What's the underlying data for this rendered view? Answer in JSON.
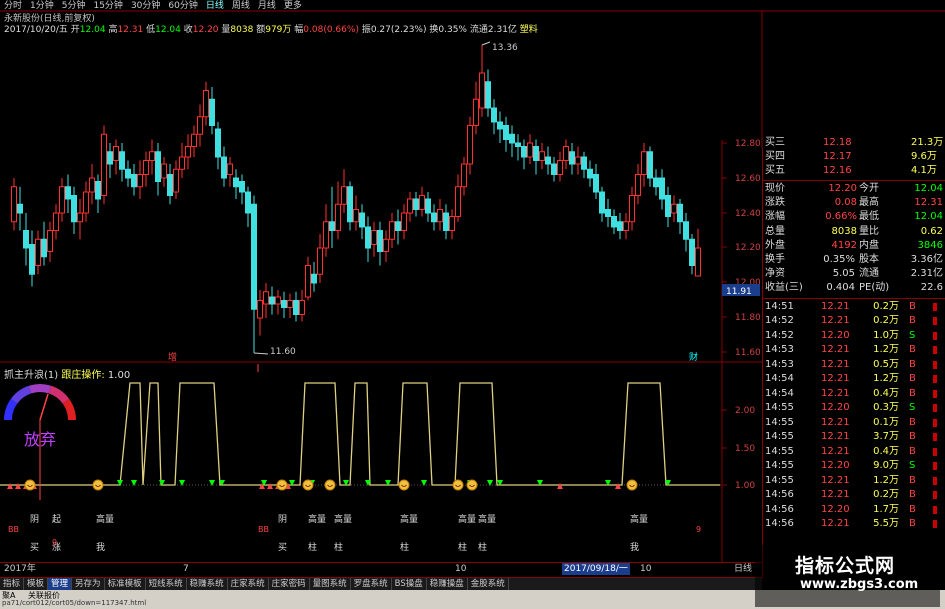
{
  "timeframes": [
    "分时",
    "1分钟",
    "5分钟",
    "15分钟",
    "30分钟",
    "60分钟",
    "日线",
    "周线",
    "月线",
    "更多"
  ],
  "active_timeframe": "日线",
  "stock_title": "永新股份(日线,前复权)",
  "info": {
    "date": "2017/10/20/五",
    "open_label": "开",
    "open": "12.04",
    "high_label": "高",
    "high": "12.31",
    "low_label": "低",
    "low": "12.04",
    "close_label": "收",
    "close": "12.20",
    "vol_label": "量",
    "vol": "8038",
    "amount_label": "额",
    "amount": "979万",
    "change_label": "幅",
    "change": "0.08(0.66%)",
    "amp_label": "振",
    "amp": "0.27(2.23%)",
    "turn_label": "换",
    "turn": "0.35%",
    "float_label": "流通",
    "float": "2.31亿",
    "type": "塑料"
  },
  "price_axis": [
    "12.80",
    "12.60",
    "12.40",
    "12.20",
    "12.00",
    "11.80",
    "11.60"
  ],
  "current_price_tag": "11.91",
  "max_label": "13.36",
  "min_label": "11.60",
  "markers": {
    "zeng": "增",
    "cai": "财"
  },
  "indicator_title": "抓主升浪(1)",
  "indicator_sub": "跟庄操作:",
  "indicator_val": "1.00",
  "gauge_text": "放弃",
  "ind_axis": [
    "2.00",
    "1.50",
    "1.00"
  ],
  "bottom_labels": [
    {
      "t": "阴",
      "sub": "买"
    },
    {
      "t": "起",
      "sub": "涨"
    },
    {
      "t": "高量",
      "sub": "我"
    },
    {
      "t": "阴",
      "sub": "买"
    },
    {
      "t": "高量",
      "sub": "柱"
    },
    {
      "t": "高量",
      "sub": "柱"
    },
    {
      "t": "高量",
      "sub": "柱"
    },
    {
      "t": "高量",
      "sub": "柱"
    },
    {
      "t": "高量",
      "sub": "柱"
    },
    {
      "t": "高量",
      "sub": "我"
    }
  ],
  "date_axis": {
    "left": "2017年",
    "m7": "7",
    "m10": "10",
    "cursor_date": "2017/09/18/一",
    "tag": "日线"
  },
  "quote": [
    {
      "label": "买三",
      "value": "12.18",
      "extra": "21.3万"
    },
    {
      "label": "买四",
      "value": "12.17",
      "extra": "9.6万"
    },
    {
      "label": "买五",
      "value": "12.16",
      "extra": "4.1万"
    }
  ],
  "stats": [
    {
      "l1": "现价",
      "v1": "12.20",
      "l2": "今开",
      "v2": "12.04"
    },
    {
      "l1": "涨跌",
      "v1": "0.08",
      "l2": "最高",
      "v2": "12.31"
    },
    {
      "l1": "涨幅",
      "v1": "0.66%",
      "l2": "最低",
      "v2": "12.04"
    },
    {
      "l1": "总量",
      "v1": "8038",
      "l2": "量比",
      "v2": "0.62"
    },
    {
      "l1": "外盘",
      "v1": "4192",
      "l2": "内盘",
      "v2": "3846"
    },
    {
      "l1": "换手",
      "v1": "0.35%",
      "l2": "股本",
      "v2": "3.36亿"
    },
    {
      "l1": "净资",
      "v1": "5.05",
      "l2": "流通",
      "v2": "2.31亿"
    },
    {
      "l1": "收益(三)",
      "v1": "0.404",
      "l2": "PE(动)",
      "v2": "22.6"
    }
  ],
  "ticks": [
    {
      "t": "14:51",
      "p": "12.21",
      "v": "0.2万",
      "s": "B"
    },
    {
      "t": "14:52",
      "p": "12.21",
      "v": "0.2万",
      "s": "B"
    },
    {
      "t": "14:52",
      "p": "12.20",
      "v": "1.0万",
      "s": "S"
    },
    {
      "t": "14:53",
      "p": "12.21",
      "v": "1.2万",
      "s": "B"
    },
    {
      "t": "14:53",
      "p": "12.21",
      "v": "0.5万",
      "s": "B"
    },
    {
      "t": "14:54",
      "p": "12.21",
      "v": "1.2万",
      "s": "B"
    },
    {
      "t": "14:54",
      "p": "12.21",
      "v": "0.4万",
      "s": "B"
    },
    {
      "t": "14:55",
      "p": "12.20",
      "v": "0.3万",
      "s": "S"
    },
    {
      "t": "14:55",
      "p": "12.21",
      "v": "0.1万",
      "s": "B"
    },
    {
      "t": "14:55",
      "p": "12.21",
      "v": "3.7万",
      "s": "B"
    },
    {
      "t": "14:55",
      "p": "12.21",
      "v": "0.4万",
      "s": "B"
    },
    {
      "t": "14:55",
      "p": "12.20",
      "v": "9.0万",
      "s": "S"
    },
    {
      "t": "14:55",
      "p": "12.21",
      "v": "1.2万",
      "s": "B"
    },
    {
      "t": "14:56",
      "p": "12.21",
      "v": "0.2万",
      "s": "B"
    },
    {
      "t": "14:56",
      "p": "12.20",
      "v": "1.7万",
      "s": "B"
    },
    {
      "t": "14:56",
      "p": "12.21",
      "v": "5.5万",
      "s": "B"
    }
  ],
  "bottom_tabs": [
    "指标",
    "模板",
    "管理",
    "另存为",
    "标准模板",
    "短线系统",
    "稳赚系统",
    "庄家系统",
    "庄家密码",
    "量图系统",
    "罗盘系统",
    "BS操盘",
    "稳赚操盘",
    "金股系统"
  ],
  "active_tab": "管理",
  "status": {
    "s1": "聚A",
    "s2": "关联报价",
    "url": "pa71/cort012/cort05/down=117347.html"
  },
  "watermark": {
    "title": "指标公式网",
    "url": "www.zbgs3.com"
  },
  "colors": {
    "up": "#ff3030",
    "down": "#40e0e0",
    "axis": "#800000",
    "ma": "#e0d080"
  }
}
